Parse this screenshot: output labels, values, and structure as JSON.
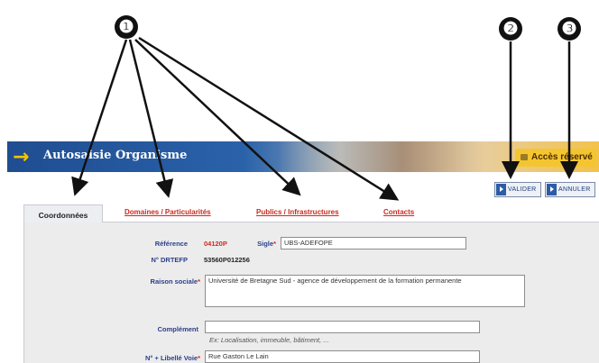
{
  "callouts": [
    "❶",
    "❷",
    "❸"
  ],
  "banner": {
    "title": "Autosaisie Organisme",
    "arrow": "→",
    "access_label": "Accès réservé"
  },
  "buttons": {
    "validate": "VALIDER",
    "cancel": "ANNULER"
  },
  "tabs": [
    {
      "label": "Coordonnées",
      "active": true
    },
    {
      "label": "Domaines / Particularités",
      "active": false
    },
    {
      "label": "Publics / Infrastructures",
      "active": false
    },
    {
      "label": "Contacts",
      "active": false
    }
  ],
  "form": {
    "reference_label": "Référence",
    "reference_value": "04120P",
    "sigle_label": "Sigle",
    "sigle_value": "UBS-ADEFOPE",
    "drtefp_label": "N° DRTEFP",
    "drtefp_value": "53560P012256",
    "raison_label": "Raison sociale",
    "raison_value": "Université de Bretagne Sud - agence de développement de la formation permanente",
    "complement_label": "Complément",
    "complement_value": "",
    "complement_hint": "Ex: Localisation, immeuble, bâtiment, ...",
    "voie_label": "N° + Libellé Voie",
    "voie_value": "Rue Gaston Le Lain",
    "required_mark": "*"
  },
  "colors": {
    "accent": "#cc2a1e",
    "label_blue": "#2b3e8c",
    "banner_blue": "#1f4d91",
    "access_yellow": "#f4c530"
  }
}
